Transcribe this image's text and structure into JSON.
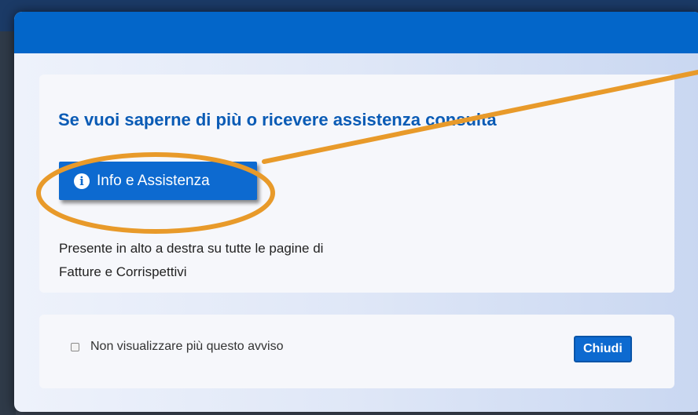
{
  "modal": {
    "headline": "Se vuoi saperne di più o ricevere assistenza consulta",
    "info_button": {
      "label": "Info e Assistenza",
      "icon": "info-circle-icon"
    },
    "description": {
      "line1": "Presente in alto a destra su tutte le pagine di",
      "line2": "Fatture e Corrispettivi"
    },
    "footer": {
      "checkbox_label": "Non visualizzare più questo avviso",
      "checkbox_checked": false,
      "close_label": "Chiudi"
    }
  },
  "colors": {
    "header_blue": "#0366c9",
    "button_blue": "#0d6ad0",
    "headline_blue": "#0a5bb5",
    "annotation_orange": "#e89a2a"
  }
}
